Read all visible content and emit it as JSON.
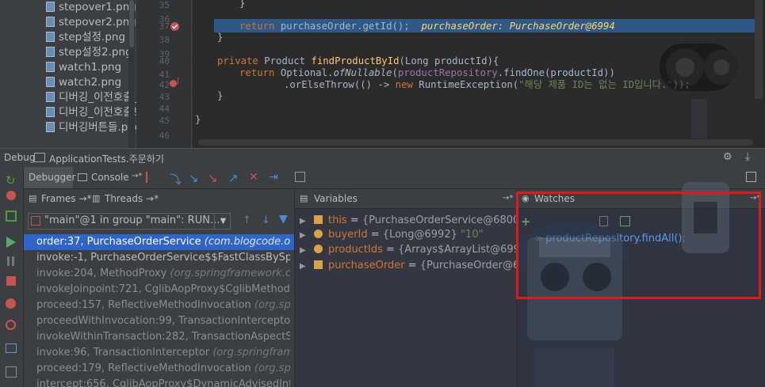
{
  "project_files": [
    "stepover1.png",
    "stepover2.png",
    "step설정.png",
    "step설정2.png",
    "watch1.png",
    "watch2.png",
    "디버깅_이전호출_코",
    "디버깅_이전호출보:",
    "디버깅버튼들.png"
  ],
  "editor": {
    "line_numbers": [
      "35",
      "36",
      "37",
      "38",
      "39",
      "40",
      "41",
      "42",
      "43",
      "44",
      "45",
      "46"
    ],
    "lines": {
      "l35": "}",
      "l37_return": "return ",
      "l37_call": "purchaseOrder.getId();",
      "l37_inline": "purchaseOrder: PurchaseOrder@6994",
      "l38": "}",
      "l40_private": "private ",
      "l40_type": "Product ",
      "l40_fn": "findProductById",
      "l40_rest": "(Long productId){",
      "l41_return": "return ",
      "l41_opt": "Optional.",
      "l41_ofnullable": "ofNullable",
      "l41_paren": "(",
      "l41_field": "productRepository",
      "l41_rest": ".findOne(productId))",
      "l42_pre": ".orElseThrow(() -> ",
      "l42_new": "new ",
      "l42_ex": "RuntimeException(",
      "l42_str": "\"해당 제품 ID는 없는 ID입니다.\"",
      "l42_end": "));",
      "l43": "}",
      "l45": "}"
    }
  },
  "debug": {
    "label": "Debug",
    "config": "ApplicationTests.주문하기",
    "tab_debugger": "Debugger",
    "tab_console": "Console",
    "tab_console_arrow": "→*"
  },
  "frames_panel": {
    "frames_tab": "Frames →*",
    "threads_tab": "Threads →*",
    "thread_selector": "\"main\"@1 in group \"main\": RUN...",
    "frames": [
      {
        "method": "order:37, PurchaseOrderService",
        "pkg": " (com.blogcode.ord"
      },
      {
        "method": "invoke:-1, PurchaseOrderService$$FastClassBySpr",
        "pkg": ""
      },
      {
        "method": "invoke:204, MethodProxy",
        "pkg": " (org.springframework.cg"
      },
      {
        "method": "invokeJoinpoint:721, CglibAopProxy$CglibMethodIn",
        "pkg": ""
      },
      {
        "method": "proceed:157, ReflectiveMethodInvocation",
        "pkg": " (org.sprin"
      },
      {
        "method": "proceedWithInvocation:99, TransactionInterceptor",
        "pkg": ""
      },
      {
        "method": "invokeWithinTransaction:282, TransactionAspectS",
        "pkg": ""
      },
      {
        "method": "invoke:96, TransactionInterceptor",
        "pkg": " (org.springframe"
      },
      {
        "method": "proceed:179, ReflectiveMethodInvocation",
        "pkg": " (org.sprin"
      },
      {
        "method": "intercept:656, CglibAopProxy$DynamicAdvisedInte",
        "pkg": ""
      }
    ]
  },
  "variables_panel": {
    "title": "Variables",
    "arrow": "→*",
    "vars": [
      {
        "name": "this",
        "eq": " = ",
        "value": "{PurchaseOrderService@6800}",
        "str": ""
      },
      {
        "name": "buyerId",
        "eq": " = ",
        "value": "{Long@6992}",
        "str": " \"10\""
      },
      {
        "name": "productIds",
        "eq": " = ",
        "value": "{Arrays$ArrayList@6993",
        "str": ""
      },
      {
        "name": "purchaseOrder",
        "eq": " = ",
        "value": "{PurchaseOrder@699",
        "str": ""
      }
    ]
  },
  "watches_panel": {
    "title": "Watches",
    "arrow": "→*",
    "expression": "productRepository.findAll();",
    "highlight_color": "#e0191b"
  },
  "colors": {
    "selection": "#2f65ca",
    "exec_line": "#2d5887",
    "panel_bg": "#3c3f41",
    "editor_bg": "#2b2b2b"
  }
}
